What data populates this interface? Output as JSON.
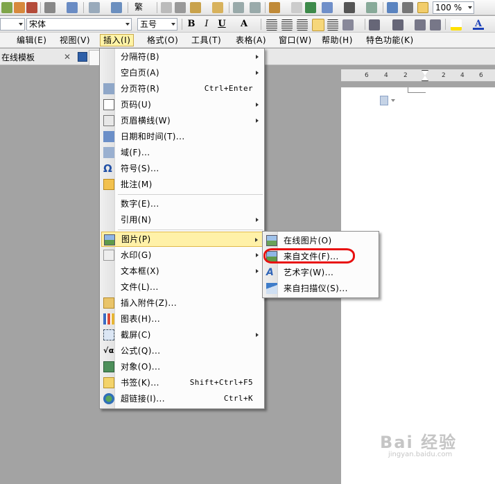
{
  "toolbar": {
    "font_name": "宋体",
    "font_size": "五号",
    "zoom": "100 %",
    "traditional_label": "繁",
    "bold": "B",
    "italic": "I",
    "underline": "U",
    "font_color_a": "A"
  },
  "menubar": {
    "items": [
      "编辑(E)",
      "视图(V)",
      "插入(I)",
      "格式(O)",
      "工具(T)",
      "表格(A)",
      "窗口(W)",
      "帮助(H)",
      "特色功能(K)"
    ]
  },
  "tabs": {
    "tab1": "在线模板"
  },
  "ruler": {
    "labels": [
      "6",
      "4",
      "2",
      "2",
      "4",
      "6"
    ]
  },
  "insert_menu": {
    "items": [
      {
        "label": "分隔符(B)",
        "shortcut": "",
        "submenu": true
      },
      {
        "label": "空白页(A)",
        "shortcut": "",
        "submenu": true
      },
      {
        "label": "分页符(R)",
        "shortcut": "Ctrl+Enter",
        "submenu": false
      },
      {
        "label": "页码(U)",
        "shortcut": "",
        "submenu": true
      },
      {
        "label": "页眉横线(W)",
        "shortcut": "",
        "submenu": true
      },
      {
        "label": "日期和时间(T)...",
        "shortcut": "",
        "submenu": false
      },
      {
        "label": "域(F)...",
        "shortcut": "",
        "submenu": false
      },
      {
        "label": "符号(S)...",
        "shortcut": "",
        "submenu": false
      },
      {
        "label": "批注(M)",
        "shortcut": "",
        "submenu": false
      },
      {
        "label": "数字(E)...",
        "shortcut": "",
        "submenu": false
      },
      {
        "label": "引用(N)",
        "shortcut": "",
        "submenu": true
      },
      {
        "label": "图片(P)",
        "shortcut": "",
        "submenu": true
      },
      {
        "label": "水印(G)",
        "shortcut": "",
        "submenu": true
      },
      {
        "label": "文本框(X)",
        "shortcut": "",
        "submenu": true
      },
      {
        "label": "文件(L)...",
        "shortcut": "",
        "submenu": false
      },
      {
        "label": "插入附件(Z)...",
        "shortcut": "",
        "submenu": false
      },
      {
        "label": "图表(H)...",
        "shortcut": "",
        "submenu": false
      },
      {
        "label": "截屏(C)",
        "shortcut": "",
        "submenu": true
      },
      {
        "label": "公式(Q)...",
        "shortcut": "",
        "submenu": false
      },
      {
        "label": "对象(O)...",
        "shortcut": "",
        "submenu": false
      },
      {
        "label": "书签(K)...",
        "shortcut": "Shift+Ctrl+F5",
        "submenu": false
      },
      {
        "label": "超链接(I)...",
        "shortcut": "Ctrl+K",
        "submenu": false
      }
    ]
  },
  "picture_submenu": {
    "items": [
      {
        "label": "在线图片(O)"
      },
      {
        "label": "来自文件(F)..."
      },
      {
        "label": "艺术字(W)..."
      },
      {
        "label": "来自扫描仪(S)..."
      }
    ]
  },
  "watermark": {
    "text": "Bai 经验",
    "sub": "jingyan.baidu.com"
  },
  "colors": {
    "menu_highlight": "#fff1a8",
    "annotation_red": "#e81010",
    "workspace": "#a3a3a3"
  }
}
